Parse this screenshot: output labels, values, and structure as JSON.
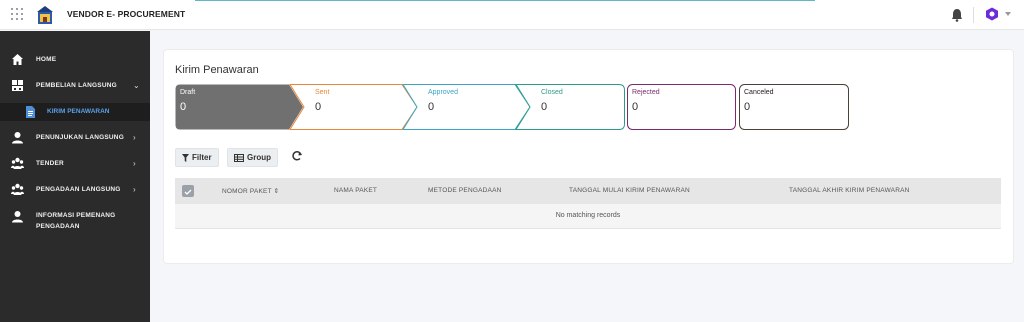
{
  "header": {
    "brand": "VENDOR E- PROCUREMENT",
    "apps_icon": "grid-apps-icon",
    "notifications_icon": "bell-icon",
    "user_icon": "hexagon-user-icon"
  },
  "sidebar": {
    "items": [
      {
        "label": "HOME",
        "icon": "home-icon"
      },
      {
        "label": "PEMBELIAN LANGSUNG",
        "icon": "building-icon",
        "expanded": true
      },
      {
        "label": "KIRIM PENAWARAN",
        "icon": "document-icon",
        "active": true
      },
      {
        "label": "PENUNJUKAN LANGSUNG",
        "icon": "user-icon"
      },
      {
        "label": "TENDER",
        "icon": "group-icon"
      },
      {
        "label": "PENGADAAN LANGSUNG",
        "icon": "group-icon"
      },
      {
        "label": "INFORMASI PEMENANG",
        "label2": "PENGADAAN",
        "icon": "user-icon"
      }
    ]
  },
  "main": {
    "title": "Kirim Penawaran",
    "steps": [
      {
        "label": "Draft",
        "count": "0",
        "color": "#707070"
      },
      {
        "label": "Sent",
        "count": "0",
        "color": "#e8873a"
      },
      {
        "label": "Approved",
        "count": "0",
        "color": "#3aa6c4"
      },
      {
        "label": "Closed",
        "count": "0",
        "color": "#2d9b8a"
      },
      {
        "label": "Rejected",
        "count": "0",
        "color": "#7a2a6e"
      },
      {
        "label": "Canceled",
        "count": "0",
        "color": "#4a4238"
      }
    ],
    "toolbar": {
      "filter_label": "Filter",
      "group_label": "Group"
    },
    "table": {
      "columns": [
        "NOMOR PAKET",
        "NAMA PAKET",
        "METODE PENGADAAN",
        "TANGGAL MULAI KIRIM PENAWARAN",
        "TANGGAL AKHIR KIRIM PENAWARAN"
      ],
      "empty_text": "No matching records"
    }
  }
}
